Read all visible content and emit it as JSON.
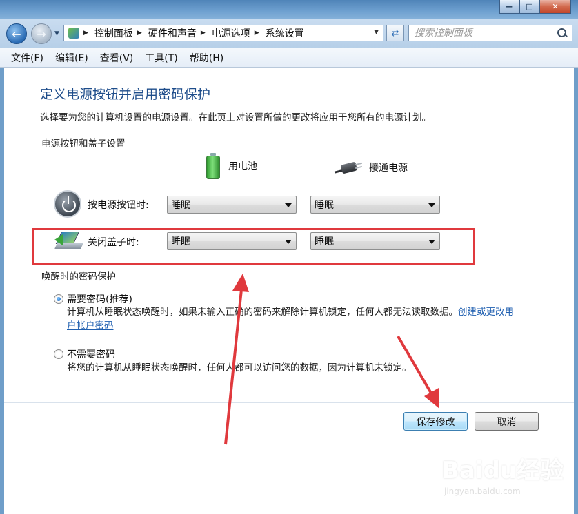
{
  "window": {
    "minimize_glyph": "—",
    "maximize_glyph": "□",
    "close_glyph": "✕"
  },
  "nav": {
    "breadcrumb": [
      "控制面板",
      "硬件和声音",
      "电源选项",
      "系统设置"
    ],
    "search_placeholder": "搜索控制面板"
  },
  "menu": [
    "文件(F)",
    "编辑(E)",
    "查看(V)",
    "工具(T)",
    "帮助(H)"
  ],
  "page": {
    "title": "定义电源按钮并启用密码保护",
    "description": "选择要为您的计算机设置的电源设置。在此页上对设置所做的更改将应用于您所有的电源计划。"
  },
  "power_settings": {
    "section_title": "电源按钮和盖子设置",
    "col_battery": "用电池",
    "col_plugged": "接通电源",
    "rows": [
      {
        "label": "按电源按钮时:",
        "battery": "睡眠",
        "plugged": "睡眠"
      },
      {
        "label": "关闭盖子时:",
        "battery": "睡眠",
        "plugged": "睡眠"
      }
    ]
  },
  "wake_password": {
    "section_title": "唤醒时的密码保护",
    "option_require": {
      "label": "需要密码(推荐)",
      "desc": "计算机从睡眠状态唤醒时，如果未输入正确的密码来解除计算机锁定，任何人都无法读取数据。",
      "link": "创建或更改用户帐户密码",
      "checked": true
    },
    "option_none": {
      "label": "不需要密码",
      "desc": "将您的计算机从睡眠状态唤醒时，任何人都可以访问您的数据，因为计算机未锁定。",
      "checked": false
    }
  },
  "buttons": {
    "save": "保存修改",
    "cancel": "取消"
  },
  "watermark": {
    "logo": "Baidu经验",
    "url": "jingyan.baidu.com"
  },
  "colors": {
    "title_blue": "#1e4d8b",
    "annotation_red": "#e0393d",
    "link_blue": "#1f5fb0"
  },
  "icons": [
    "back-arrow-icon",
    "forward-arrow-icon",
    "control-panel-icon",
    "refresh-icon",
    "search-icon",
    "battery-icon",
    "plug-icon",
    "power-button-icon",
    "laptop-lid-icon"
  ]
}
